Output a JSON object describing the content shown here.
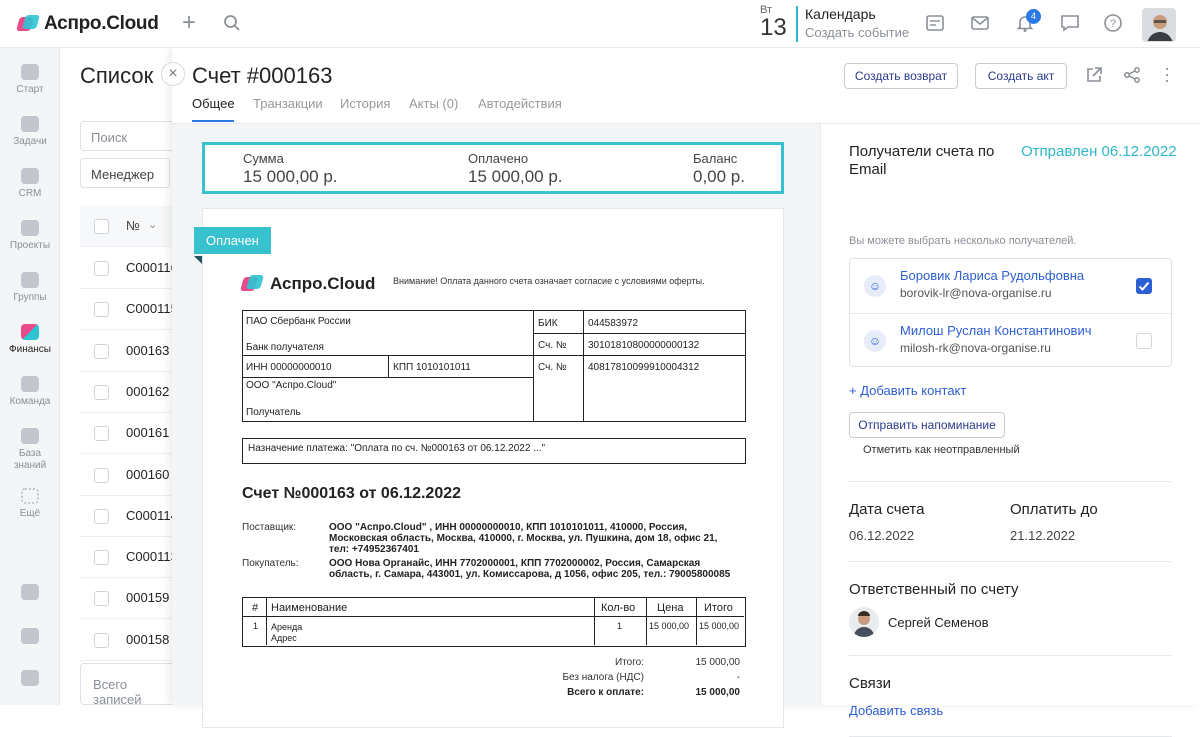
{
  "topbar": {
    "logo": "Аспро.Cloud",
    "calendar": {
      "weekday": "Вт",
      "day": "13",
      "title": "Календарь",
      "create": "Создать событие"
    },
    "notifications_count": "4"
  },
  "sidebar": {
    "items": [
      {
        "label": "Старт",
        "icon": "start-icon"
      },
      {
        "label": "Задачи",
        "icon": "tasks-icon"
      },
      {
        "label": "CRM",
        "icon": "crm-icon"
      },
      {
        "label": "Проекты",
        "icon": "projects-icon"
      },
      {
        "label": "Группы",
        "icon": "groups-icon"
      },
      {
        "label": "Финансы",
        "icon": "finance-icon"
      },
      {
        "label": "Команда",
        "icon": "team-icon"
      },
      {
        "label": "База знаний",
        "icon": "knowledge-icon"
      },
      {
        "label": "Ещё",
        "icon": "more-icon"
      }
    ]
  },
  "list": {
    "title": "Список",
    "search_placeholder": "Поиск",
    "filter": "Менеджер",
    "column": "№",
    "rows": [
      "С000116",
      "С000115",
      "000163",
      "000162",
      "000161",
      "000160",
      "С000114",
      "С000113",
      "000159",
      "000158"
    ],
    "footer": "Всего записей"
  },
  "invoice": {
    "title": "Счет #000163",
    "tabs": [
      "Общее",
      "Транзакции",
      "История",
      "Акты (0)",
      "Автодействия"
    ],
    "buttons": {
      "return": "Создать возврат",
      "act": "Создать акт"
    },
    "summary": {
      "sum_label": "Сумма",
      "sum_value": "15 000,00 р.",
      "paid_label": "Оплачено",
      "paid_value": "15 000,00 р.",
      "balance_label": "Баланс",
      "balance_value": "0,00 р."
    },
    "status_tag": "Оплачен",
    "document": {
      "logo": "Аспро.Cloud",
      "notice": "Внимание! Оплата данного счета означает согласие с условиями оферты.",
      "bank_name": "ПАО Сбербанк России",
      "bank_recipient_label": "Банк получателя",
      "bik_label": "БИК",
      "bik": "044583972",
      "acc_label": "Сч. №",
      "acc1": "30101810800000000132",
      "acc2": "40817810099910004312",
      "inn": "ИНН 00000000010",
      "kpp": "КПП 1010101011",
      "company": "ООО \"Аспро.Cloud\"",
      "recipient_label": "Получатель",
      "purpose": "Назначение платежа: \"Оплата по сч. №000163 от 06.12.2022 ...\"",
      "heading": "Счет №000163 от 06.12.2022",
      "supplier_label": "Поставщик:",
      "supplier": "ООО \"Аспро.Cloud\" , ИНН 00000000010, КПП 1010101011, 410000, Россия, Московская область, Москва, 410000, г. Москва, ул. Пушкина, дом 18, офис 21, тел: +74952367401",
      "buyer_label": "Покупатель:",
      "buyer": "ООО Нова Органайс, ИНН 7702000001, КПП 7702000002, Россия, Самарская область, г. Самара, 443001, ул. Комиссарова, д 1056, офис 205, тел.: 79005800085",
      "table_headers": [
        "#",
        "Наименование",
        "Кол-во",
        "Цена",
        "Итого"
      ],
      "table_rows": [
        {
          "n": "1",
          "name": "Аренда",
          "sub": "Адрес",
          "qty": "1",
          "price": "15 000,00",
          "total": "15 000,00"
        }
      ],
      "totals": [
        {
          "label": "Итого:",
          "value": "15 000,00"
        },
        {
          "label": "Без налога (НДС)",
          "value": "-"
        },
        {
          "label": "Всего к оплате:",
          "value": "15 000,00"
        }
      ]
    },
    "right": {
      "recipients_title": "Получатели счета по Email",
      "sent_status": "Отправлен 06.12.2022",
      "recipients_hint": "Вы можете выбрать несколько получателей.",
      "recipients": [
        {
          "name": "Боровик Лариса Рудольфовна",
          "email": "borovik-lr@nova-organise.ru",
          "checked": true
        },
        {
          "name": "Милош Руслан Константинович",
          "email": "milosh-rk@nova-organise.ru",
          "checked": false
        }
      ],
      "add_contact": "+ Добавить контакт",
      "remind_button": "Отправить напоминание",
      "mark_unsent": "Отметить как неотправленный",
      "date_label": "Дата счета",
      "date_value": "06.12.2022",
      "due_label": "Оплатить до",
      "due_value": "21.12.2022",
      "responsible_title": "Ответственный по счету",
      "responsible_name": "Сергей Семенов",
      "links_title": "Связи",
      "add_link": "Добавить связь"
    }
  },
  "colors": {
    "accent": "#38c1cf",
    "link": "#2c5fd4",
    "primary_btn_text": "#2b3a8c"
  }
}
